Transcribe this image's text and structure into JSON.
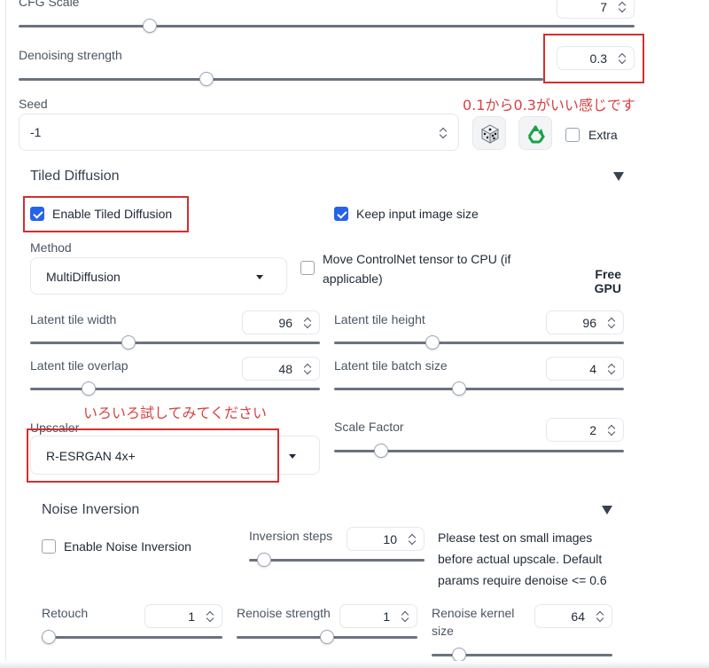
{
  "cfg": {
    "label": "CFG Scale",
    "value": "7",
    "slider": 0.21
  },
  "denoise": {
    "label": "Denoising strength",
    "value": "0.3",
    "slider": 0.3
  },
  "seed": {
    "label": "Seed",
    "value": "-1",
    "extra_label": "Extra"
  },
  "annotations": {
    "denoise_note": "0.1から0.3がいい感じです",
    "upscaler_note": "いろいろ試してみてください"
  },
  "tiled": {
    "title": "Tiled Diffusion",
    "enable_label": "Enable Tiled Diffusion",
    "keep_label": "Keep input image size",
    "method_label": "Method",
    "method_value": "MultiDiffusion",
    "move_cn_label_1": "Move ControlNet tensor to CPU (if",
    "move_cn_label_2": "applicable)",
    "free_gpu_1": "Free",
    "free_gpu_2": "GPU",
    "tile_width": {
      "label": "Latent tile width",
      "value": "96",
      "slider": 0.34
    },
    "tile_height": {
      "label": "Latent tile height",
      "value": "96",
      "slider": 0.34
    },
    "tile_overlap": {
      "label": "Latent tile overlap",
      "value": "48",
      "slider": 0.2
    },
    "tile_batch": {
      "label": "Latent tile batch size",
      "value": "4",
      "slider": 0.43
    },
    "upscaler_label": "Upscaler",
    "upscaler_value": "R-ESRGAN 4x+",
    "scale_factor": {
      "label": "Scale Factor",
      "value": "2",
      "slider": 0.16
    }
  },
  "noise": {
    "title": "Noise Inversion",
    "enable_label": "Enable Noise Inversion",
    "steps": {
      "label": "Inversion steps",
      "value": "10",
      "slider": 0.05
    },
    "note_1": "Please test on small images",
    "note_2": "before actual upscale. Default",
    "note_3": "params require denoise <= 0.6",
    "retouch": {
      "label": "Retouch",
      "value": "1",
      "slider": 0.0
    },
    "renoise": {
      "label": "Renoise strength",
      "value": "1",
      "slider": 0.5
    },
    "kernel": {
      "label_1": "Renoise kernel",
      "label_2": "size",
      "value": "64",
      "slider": 0.15
    }
  }
}
